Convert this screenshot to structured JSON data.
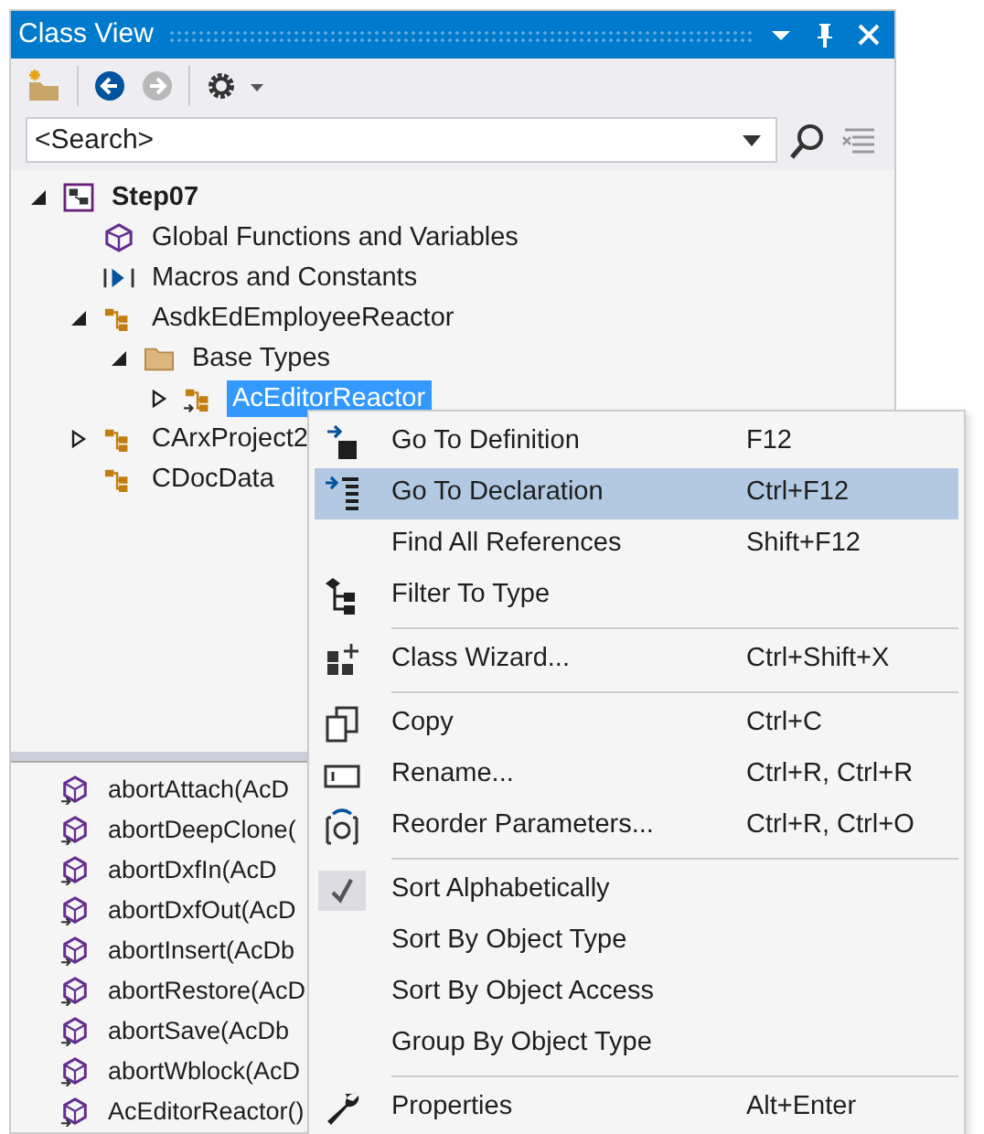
{
  "window": {
    "title": "Class View",
    "buttons": [
      {
        "kind": "dropdown"
      },
      {
        "kind": "pin"
      },
      {
        "kind": "close"
      }
    ]
  },
  "toolbar": [
    {
      "kind": "new-folder",
      "disabled": false
    },
    {
      "kind": "separator"
    },
    {
      "kind": "back",
      "disabled": false
    },
    {
      "kind": "forward",
      "disabled": true
    },
    {
      "kind": "separator"
    },
    {
      "kind": "settings",
      "disabled": false
    }
  ],
  "search": {
    "placeholder": "<Search>"
  },
  "tree": [
    {
      "label": "Step07",
      "kind": "project",
      "expanded": true,
      "selected": false,
      "children": [
        {
          "label": "Global Functions and Variables",
          "kind": "global",
          "selected": false
        },
        {
          "label": "Macros and Constants",
          "kind": "macro",
          "selected": false
        },
        {
          "label": "AsdkEdEmployeeReactor",
          "kind": "class",
          "expanded": true,
          "selected": false,
          "children": [
            {
              "label": "Base Types",
              "kind": "folder",
              "expanded": true,
              "selected": false,
              "children": [
                {
                  "label": "AcEditorReactor",
                  "kind": "class-ref",
                  "expanded": false,
                  "selected": true
                }
              ]
            }
          ]
        },
        {
          "label": "CArxProject2",
          "kind": "class",
          "expanded": false,
          "selected": false
        },
        {
          "label": "CDocData",
          "kind": "class",
          "selected": false
        }
      ]
    }
  ],
  "members": [
    "abortAttach(AcD",
    "abortDeepClone(",
    "abortDxfIn(AcD",
    "abortDxfOut(AcD",
    "abortInsert(AcDb",
    "abortRestore(AcD",
    "abortSave(AcDb",
    "abortWblock(AcD",
    "AcEditorReactor()"
  ],
  "context_menu": [
    {
      "kind": "goto-definition",
      "label": "Go To Definition",
      "shortcut": "F12",
      "selected": false
    },
    {
      "kind": "goto-declaration",
      "label": "Go To Declaration",
      "shortcut": "Ctrl+F12",
      "selected": true
    },
    {
      "kind": "plain",
      "label": "Find All References",
      "shortcut": "Shift+F12",
      "selected": false
    },
    {
      "kind": "filter",
      "label": "Filter To Type",
      "selected": false
    },
    {
      "kind": "separator"
    },
    {
      "kind": "wizard",
      "label": "Class Wizard...",
      "shortcut": "Ctrl+Shift+X",
      "selected": false
    },
    {
      "kind": "separator"
    },
    {
      "kind": "copy",
      "label": "Copy",
      "shortcut": "Ctrl+C",
      "selected": false
    },
    {
      "kind": "rename",
      "label": "Rename...",
      "shortcut": "Ctrl+R, Ctrl+R",
      "selected": false
    },
    {
      "kind": "reorder",
      "label": "Reorder Parameters...",
      "shortcut": "Ctrl+R, Ctrl+O",
      "selected": false
    },
    {
      "kind": "separator"
    },
    {
      "kind": "check",
      "label": "Sort Alphabetically",
      "checked": true,
      "selected": false
    },
    {
      "kind": "check",
      "label": "Sort By Object Type",
      "checked": false,
      "selected": false
    },
    {
      "kind": "check",
      "label": "Sort By Object Access",
      "checked": false,
      "selected": false
    },
    {
      "kind": "check",
      "label": "Group By Object Type",
      "checked": false,
      "selected": false
    },
    {
      "kind": "separator"
    },
    {
      "kind": "wrench",
      "label": "Properties",
      "shortcut": "Alt+Enter",
      "selected": false
    }
  ]
}
